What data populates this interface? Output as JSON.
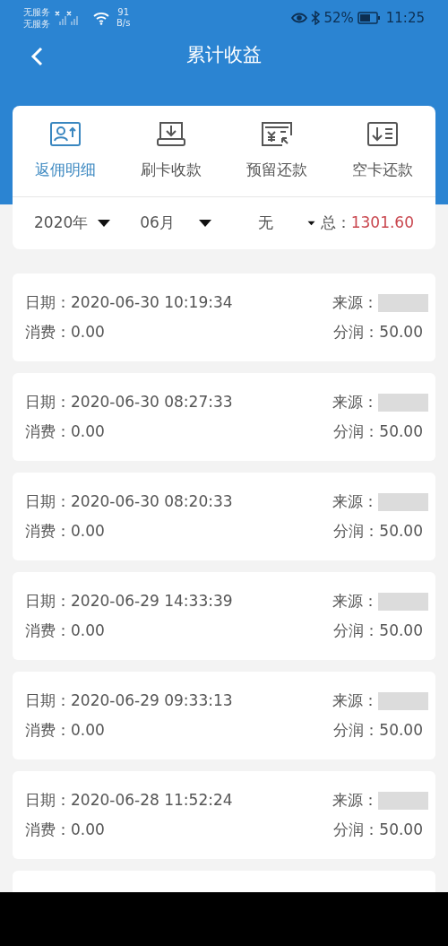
{
  "status_bar": {
    "carrier_1": "无服务",
    "carrier_2": "无服务",
    "speed_value": "91",
    "speed_unit": "B/s",
    "battery": "52%",
    "time": "11:25"
  },
  "header": {
    "title": "累计收益"
  },
  "tabs": [
    {
      "label": "返佣明细",
      "selected": true
    },
    {
      "label": "刷卡收款",
      "selected": false
    },
    {
      "label": "预留还款",
      "selected": false
    },
    {
      "label": "空卡还款",
      "selected": false
    }
  ],
  "filters": [
    {
      "label": "2020年"
    },
    {
      "label": "06月"
    },
    {
      "label": "无"
    }
  ],
  "total": {
    "label": "总：",
    "value": "1301.60"
  },
  "records": [
    {
      "date": "日期：2020-06-30 10:19:34",
      "source": "来源：",
      "spend": "消费：0.00",
      "share": "分润：50.00"
    },
    {
      "date": "日期：2020-06-30 08:27:33",
      "source": "来源：",
      "spend": "消费：0.00",
      "share": "分润：50.00"
    },
    {
      "date": "日期：2020-06-30 08:20:33",
      "source": "来源：",
      "spend": "消费：0.00",
      "share": "分润：50.00"
    },
    {
      "date": "日期：2020-06-29 14:33:39",
      "source": "来源：",
      "spend": "消费：0.00",
      "share": "分润：50.00"
    },
    {
      "date": "日期：2020-06-29 09:33:13",
      "source": "来源：",
      "spend": "消费：0.00",
      "share": "分润：50.00"
    },
    {
      "date": "日期：2020-06-28 11:52:24",
      "source": "来源：",
      "spend": "消费：0.00",
      "share": "分润：50.00"
    }
  ]
}
